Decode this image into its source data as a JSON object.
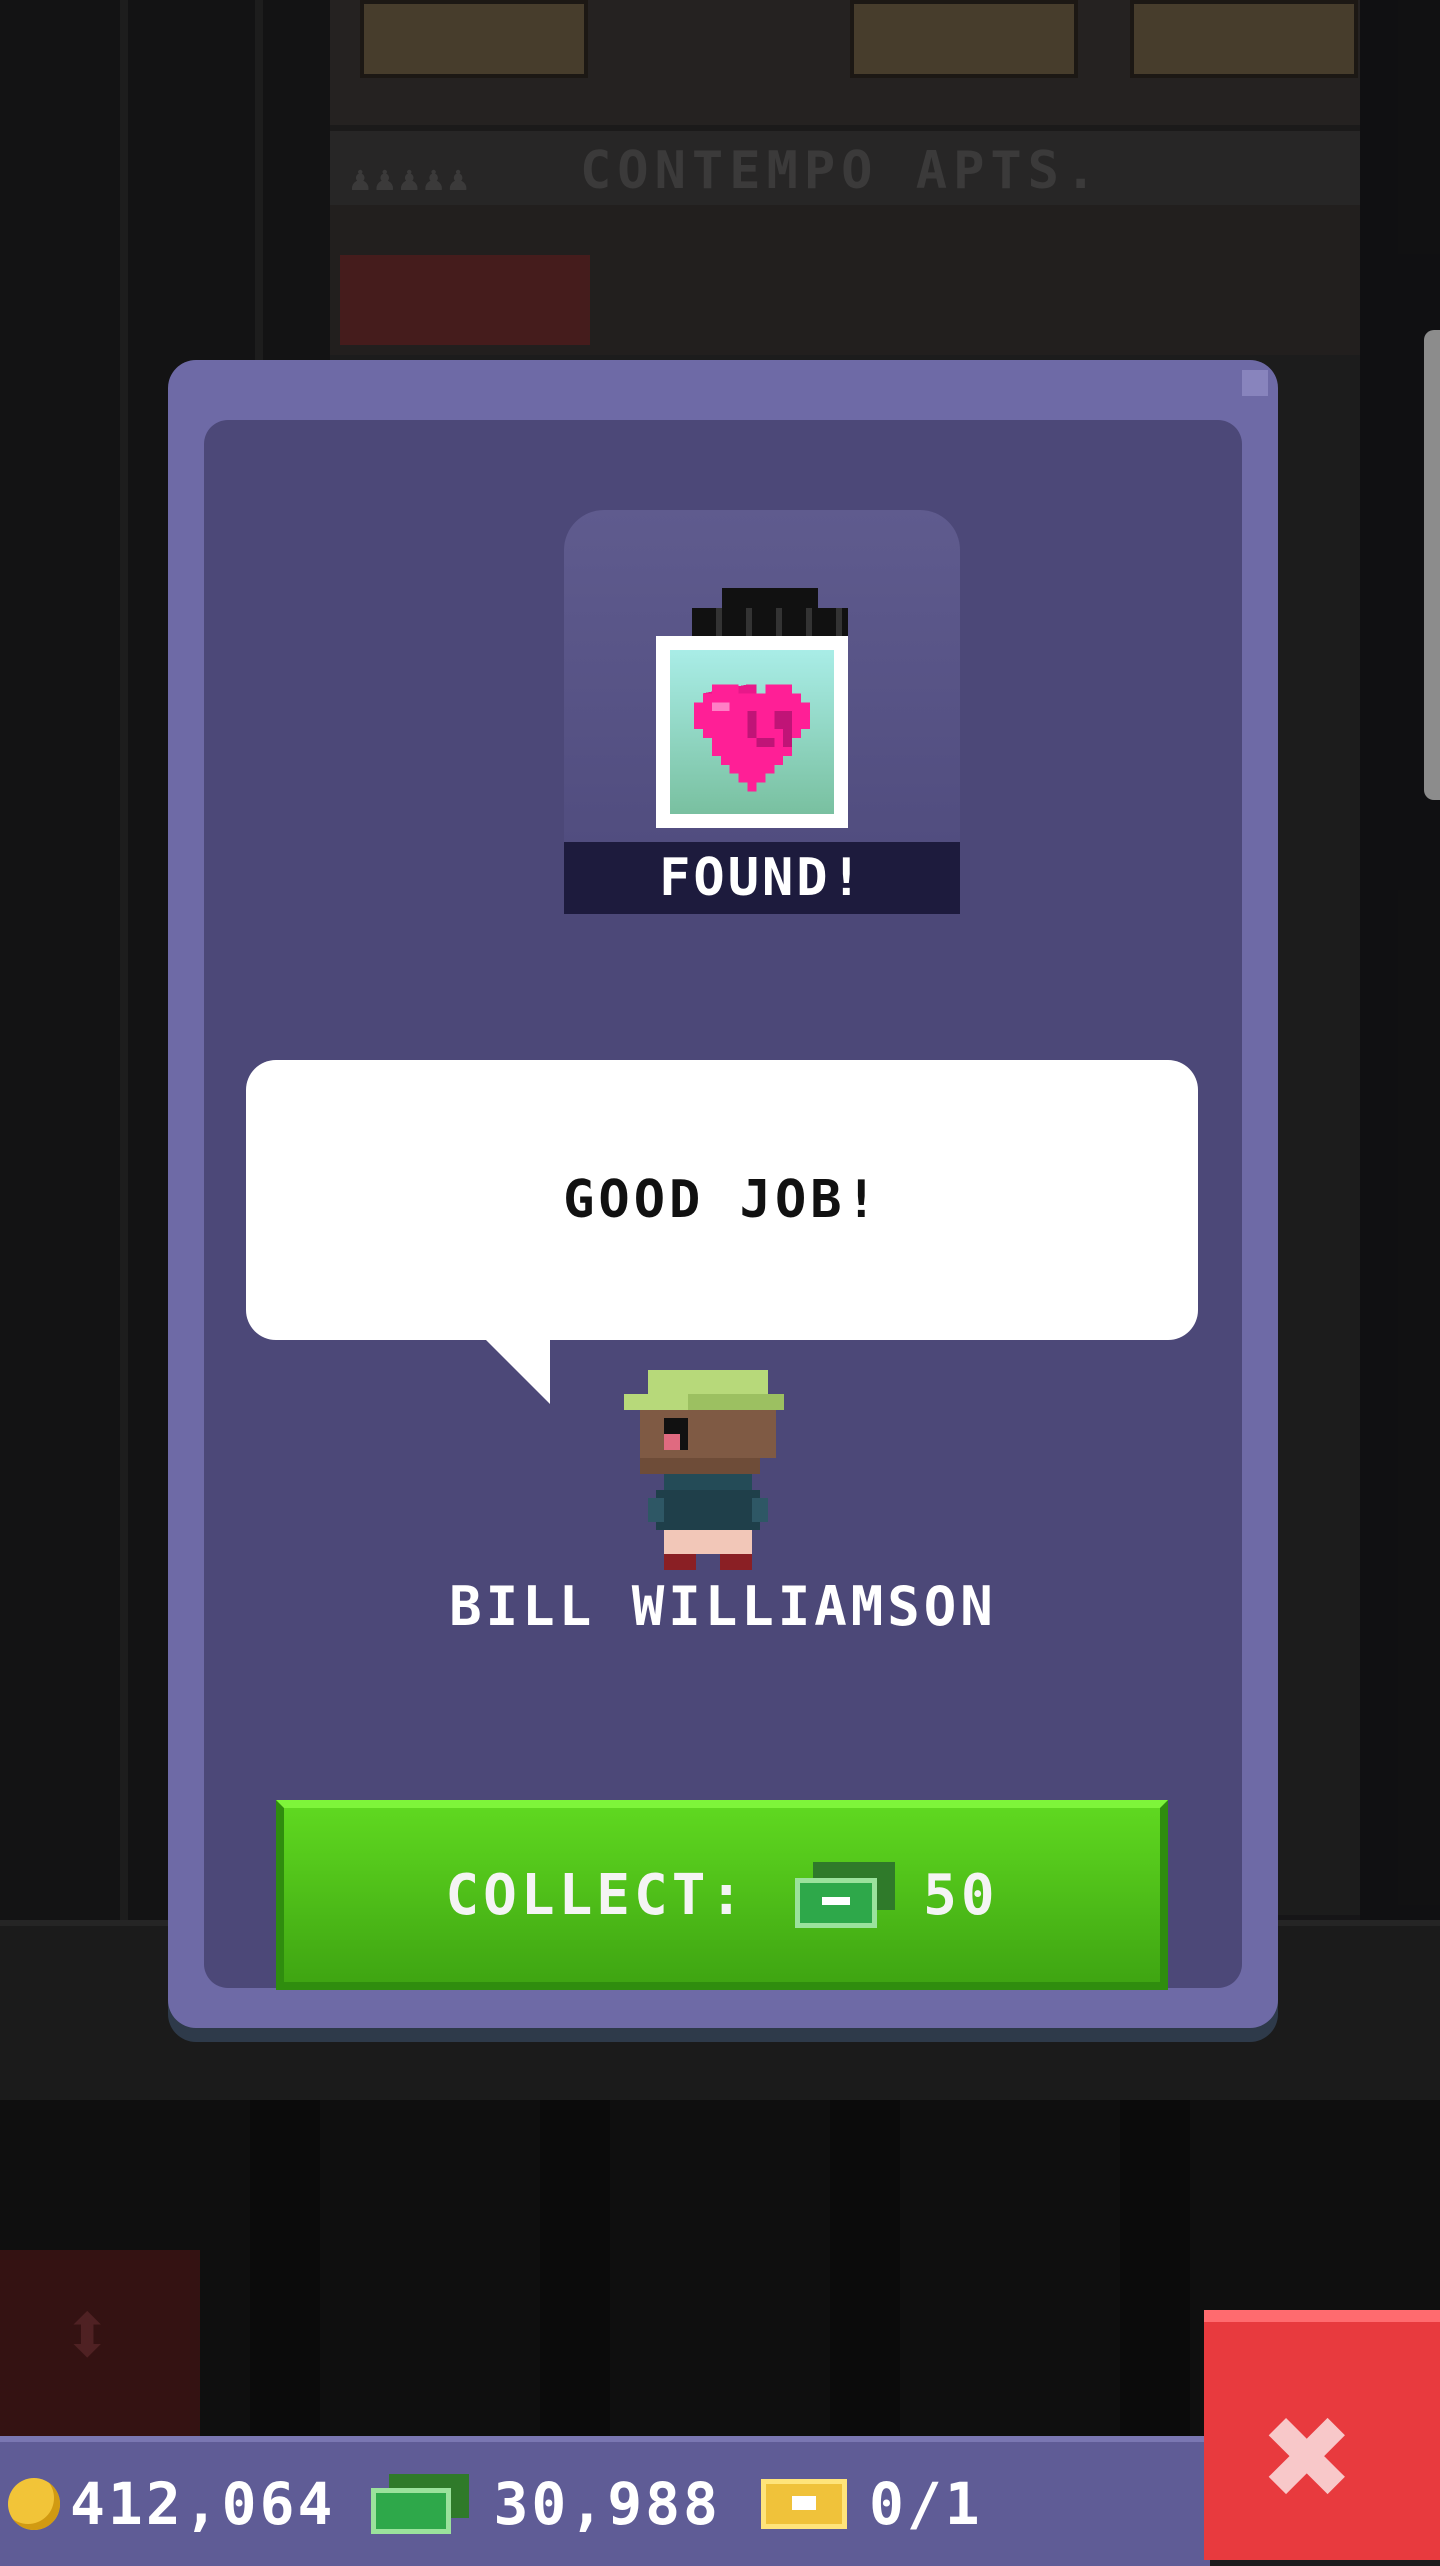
{
  "building": {
    "floor_sign": "CONTEMPO APTS."
  },
  "modal": {
    "badge_label": "FOUND!",
    "badge_icon": "heart-picture-icon",
    "speech": "GOOD JOB!",
    "character_name": "BILL WILLIAMSON",
    "collect_label": "COLLECT:",
    "collect_amount": "50",
    "collect_currency_icon": "bux-icon"
  },
  "hud": {
    "coins": "412,064",
    "bux": "30,988",
    "tickets": "0/1"
  },
  "colors": {
    "card_outer": "#6e6aa6",
    "card_inner": "#4c4878",
    "collect_green": "#4fc41a",
    "close_red": "#e83a3e",
    "hud_bg": "#5f5c96"
  }
}
